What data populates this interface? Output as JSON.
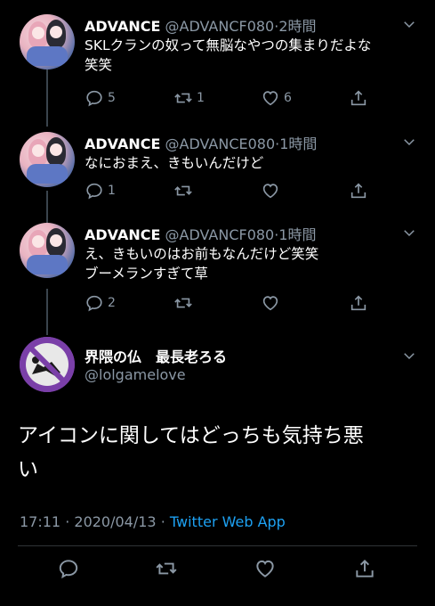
{
  "replies": [
    {
      "name": "ADVANCE",
      "handle": "@ADVANCF080",
      "time": "2時間",
      "text_lines": [
        "SKLクランの奴って無脳なやつの集まりだよな",
        "笑笑"
      ],
      "reply_count": "5",
      "retweet_count": "1",
      "like_count": "6"
    },
    {
      "name": "ADVANCE",
      "handle": "@ADVANCE080",
      "time": "1時間",
      "text_lines": [
        "なにおまえ、きもいんだけど"
      ],
      "reply_count": "1",
      "retweet_count": "",
      "like_count": ""
    },
    {
      "name": "ADVANCE",
      "handle": "@ADVANCF080",
      "time": "1時間",
      "text_lines": [
        "え、きもいのはお前もなんだけど笑笑",
        "ブーメランすぎて草"
      ],
      "reply_count": "2",
      "retweet_count": "",
      "like_count": ""
    }
  ],
  "main": {
    "name": "界隈の仏　最長老ろる",
    "handle": "@lolgamelove",
    "text_lines": [
      "アイコンに関してはどっちも気持ち悪",
      "い"
    ],
    "time": "17:11",
    "date": "2020/04/13",
    "separator": "·",
    "source": "Twitter Web App"
  },
  "dot": "·",
  "icons": {
    "reply": "reply-icon",
    "retweet": "retweet-icon",
    "like": "heart-icon",
    "share": "share-icon",
    "caret": "chevron-down-icon"
  },
  "colors": {
    "background": "#000000",
    "secondary_text": "#8b98a5",
    "link": "#1da1f2",
    "thread_line": "#3a444d"
  }
}
